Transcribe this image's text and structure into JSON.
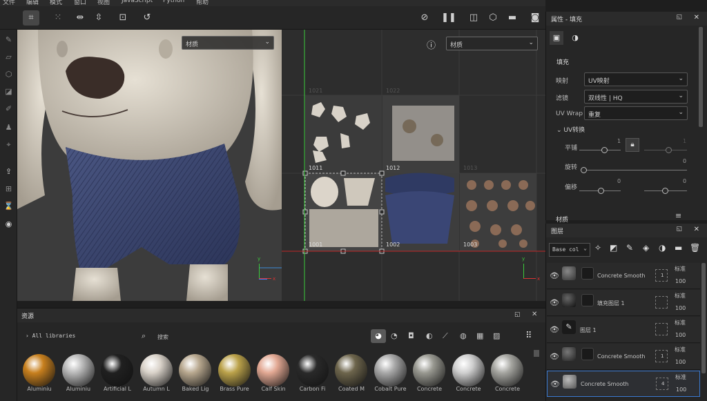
{
  "menu": [
    "文件",
    "编辑",
    "模式",
    "窗口",
    "视图",
    "JavaScript",
    "Python",
    "帮助"
  ],
  "viewport": {
    "left_dropdown": "材质",
    "right_dropdown": "材质",
    "uv_tiles": [
      "1021",
      "1022",
      "1011",
      "1012",
      "1013",
      "1001",
      "1002",
      "1003"
    ],
    "axes": {
      "y": "y",
      "x": "x"
    }
  },
  "properties": {
    "title": "属性 - 填充",
    "section": "填充",
    "mapping_label": "映射",
    "mapping_value": "UV映射",
    "filter_label": "滤镜",
    "filter_value": "双线性 | HQ",
    "wrap_label": "UV Wrap",
    "wrap_value": "重复",
    "uv_transform_label": "UV转换",
    "tile_label": "平铺",
    "tile_a": "1",
    "tile_b": "1",
    "rotate_label": "旋转",
    "rotate_value": "0",
    "offset_label": "偏移",
    "offset_a": "0",
    "offset_b": "0",
    "material_label": "材质"
  },
  "layers": {
    "title": "图层",
    "channel": "Base col",
    "rows": [
      {
        "name": "Concrete Smooth",
        "blend": "标准",
        "opacity": "100",
        "count": "1"
      },
      {
        "name": "填充图层 1",
        "blend": "标准",
        "opacity": "100",
        "count": ""
      },
      {
        "name": "图层 1",
        "blend": "标准",
        "opacity": "100",
        "count": ""
      },
      {
        "name": "Concrete Smooth",
        "blend": "标准",
        "opacity": "100",
        "count": "1"
      },
      {
        "name": "Concrete Smooth",
        "blend": "标准",
        "opacity": "100",
        "count": "4"
      }
    ]
  },
  "assets": {
    "title": "资源",
    "libraries": "All libraries",
    "search_placeholder": "搜索",
    "materials": [
      {
        "name": "Aluminiu",
        "color": "#c8801e"
      },
      {
        "name": "Aluminiu",
        "color": "#b8b8b8"
      },
      {
        "name": "Artificial L",
        "color": "#202020"
      },
      {
        "name": "Autumn L",
        "color": "#d9d2c9"
      },
      {
        "name": "Baked Lig",
        "color": "#b8a88f"
      },
      {
        "name": "Brass Pure",
        "color": "#bba24a"
      },
      {
        "name": "Calf Skin",
        "color": "#e2a893"
      },
      {
        "name": "Carbon Fi",
        "color": "#2a2a2a"
      },
      {
        "name": "Coated M",
        "color": "#6d654c"
      },
      {
        "name": "Cobalt Pure",
        "color": "#a8a8a8"
      },
      {
        "name": "Concrete",
        "color": "#989890"
      },
      {
        "name": "Concrete",
        "color": "#cfcfcf"
      },
      {
        "name": "Concrete",
        "color": "#a5a5a0"
      }
    ]
  }
}
